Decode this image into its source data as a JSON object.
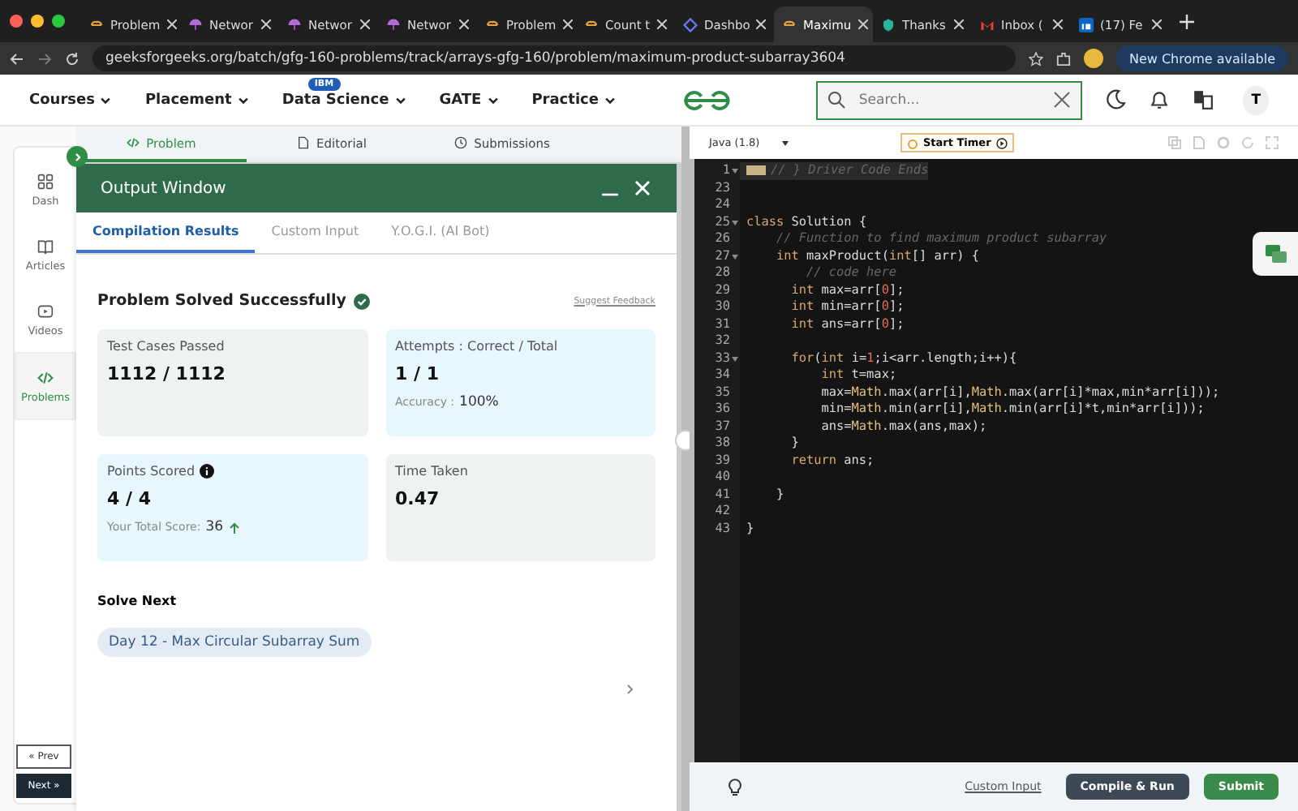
{
  "browser": {
    "tabs": [
      {
        "title": "Problem",
        "selected": false,
        "kind": "gfg"
      },
      {
        "title": "Networ",
        "selected": false,
        "kind": "umbrella"
      },
      {
        "title": "Networ",
        "selected": false,
        "kind": "umbrella"
      },
      {
        "title": "Networ",
        "selected": false,
        "kind": "umbrella"
      },
      {
        "title": "Problem",
        "selected": false,
        "kind": "gfg"
      },
      {
        "title": "Count t",
        "selected": false,
        "kind": "gfg"
      },
      {
        "title": "Dashbo",
        "selected": false,
        "kind": "diamond"
      },
      {
        "title": "Maximu",
        "selected": true,
        "kind": "gfg"
      },
      {
        "title": "Thanks",
        "selected": false,
        "kind": "shield"
      },
      {
        "title": "Inbox (",
        "selected": false,
        "kind": "mail"
      },
      {
        "title": "(17) Fe",
        "selected": false,
        "kind": "network"
      }
    ],
    "url": "geeksforgeeks.org/batch/gfg-160-problems/track/arrays-gfg-160/problem/maximum-product-subarray3604",
    "update_button": "New Chrome available"
  },
  "nav": {
    "items": [
      {
        "label": "Courses"
      },
      {
        "label": "Placement"
      },
      {
        "label": "Data Science",
        "badge": "IBM"
      },
      {
        "label": "GATE"
      },
      {
        "label": "Practice"
      }
    ],
    "search": {
      "placeholder": "Search..."
    },
    "avatar": "T"
  },
  "sidebar": {
    "items": [
      {
        "label": "Dash",
        "kind": "grid",
        "selected": false
      },
      {
        "label": "Articles",
        "kind": "book",
        "selected": false
      },
      {
        "label": "Videos",
        "kind": "video",
        "selected": false
      },
      {
        "label": "Problems",
        "kind": "code",
        "selected": true
      }
    ],
    "prev": "« Prev",
    "next": "Next »"
  },
  "problem_tabs": [
    {
      "label": "Problem",
      "kind": "code",
      "selected": true
    },
    {
      "label": "Editorial",
      "kind": "document",
      "selected": false
    },
    {
      "label": "Submissions",
      "kind": "clock",
      "selected": false
    }
  ],
  "output_window": {
    "title": "Output Window",
    "tabs": [
      {
        "label": "Compilation Results",
        "selected": true
      },
      {
        "label": "Custom Input",
        "selected": false
      },
      {
        "label": "Y.O.G.I. (AI Bot)",
        "selected": false
      }
    ],
    "status": "Problem Solved Successfully",
    "feedback_link": "Suggest Feedback",
    "cards": [
      {
        "label": "Test Cases Passed",
        "value": "1112 / 1112",
        "kind": "plain"
      },
      {
        "label": "Attempts : Correct / Total",
        "value": "1 / 1",
        "kind": "highlight",
        "sub_label": "Accuracy :",
        "sub_value": "100%"
      },
      {
        "label": "Points Scored",
        "value": "4 / 4",
        "kind": "highlight",
        "info": true,
        "sub_label": "Your Total Score:",
        "sub_value": "36",
        "rising": true
      },
      {
        "label": "Time Taken",
        "value": "0.47",
        "kind": "plain"
      }
    ],
    "solve_next": {
      "heading": "Solve Next",
      "items": [
        "Day 12 - Max Circular Subarray Sum"
      ]
    }
  },
  "editor": {
    "language": "Java (1.8)",
    "timer_button": "Start Timer",
    "lines": [
      {
        "number": "1",
        "fold": true,
        "collapsed": true,
        "segments": [
          {
            "kind": "comment",
            "text": "// } Driver Code Ends"
          }
        ]
      },
      {
        "number": "23",
        "fold": false
      },
      {
        "number": "24",
        "fold": false
      },
      {
        "number": "25",
        "fold": true,
        "segments": [
          {
            "kind": "keyword",
            "text": "class"
          },
          {
            "kind": "plain",
            "text": " Solution {"
          }
        ]
      },
      {
        "number": "26",
        "fold": false,
        "segments": [
          {
            "kind": "comment",
            "text": "    // Function to find maximum product subarray"
          }
        ]
      },
      {
        "number": "27",
        "fold": true,
        "segments": [
          {
            "kind": "keyword",
            "text": "    int"
          },
          {
            "kind": "plain",
            "text": " maxProduct("
          },
          {
            "kind": "keyword",
            "text": "int"
          },
          {
            "kind": "plain",
            "text": "[] arr) {"
          }
        ]
      },
      {
        "number": "28",
        "fold": false,
        "segments": [
          {
            "kind": "comment",
            "text": "        // code here"
          }
        ]
      },
      {
        "number": "29",
        "fold": false,
        "segments": [
          {
            "kind": "keyword",
            "text": "      int"
          },
          {
            "kind": "plain",
            "text": " max=arr["
          },
          {
            "kind": "number",
            "text": "0"
          },
          {
            "kind": "plain",
            "text": "];"
          }
        ]
      },
      {
        "number": "30",
        "fold": false,
        "segments": [
          {
            "kind": "keyword",
            "text": "      int"
          },
          {
            "kind": "plain",
            "text": " min=arr["
          },
          {
            "kind": "number",
            "text": "0"
          },
          {
            "kind": "plain",
            "text": "];"
          }
        ]
      },
      {
        "number": "31",
        "fold": false,
        "segments": [
          {
            "kind": "keyword",
            "text": "      int"
          },
          {
            "kind": "plain",
            "text": " ans=arr["
          },
          {
            "kind": "number",
            "text": "0"
          },
          {
            "kind": "plain",
            "text": "];"
          }
        ]
      },
      {
        "number": "32",
        "fold": false
      },
      {
        "number": "33",
        "fold": true,
        "segments": [
          {
            "kind": "keyword",
            "text": "      for"
          },
          {
            "kind": "plain",
            "text": "("
          },
          {
            "kind": "keyword",
            "text": "int"
          },
          {
            "kind": "plain",
            "text": " i="
          },
          {
            "kind": "number",
            "text": "1"
          },
          {
            "kind": "plain",
            "text": ";i<arr.length;i++){"
          }
        ]
      },
      {
        "number": "34",
        "fold": false,
        "segments": [
          {
            "kind": "keyword",
            "text": "          int"
          },
          {
            "kind": "plain",
            "text": " t=max;"
          }
        ]
      },
      {
        "number": "35",
        "fold": false,
        "segments": [
          {
            "kind": "plain",
            "text": "          max="
          },
          {
            "kind": "class",
            "text": "Math"
          },
          {
            "kind": "plain",
            "text": ".max(arr[i],"
          },
          {
            "kind": "class",
            "text": "Math"
          },
          {
            "kind": "plain",
            "text": ".max(arr[i]*max,min*arr[i]));"
          }
        ]
      },
      {
        "number": "36",
        "fold": false,
        "segments": [
          {
            "kind": "plain",
            "text": "          min="
          },
          {
            "kind": "class",
            "text": "Math"
          },
          {
            "kind": "plain",
            "text": ".min(arr[i],"
          },
          {
            "kind": "class",
            "text": "Math"
          },
          {
            "kind": "plain",
            "text": ".min(arr[i]*t,min*arr[i]));"
          }
        ]
      },
      {
        "number": "37",
        "fold": false,
        "segments": [
          {
            "kind": "plain",
            "text": "          ans="
          },
          {
            "kind": "class",
            "text": "Math"
          },
          {
            "kind": "plain",
            "text": ".max(ans,max);"
          }
        ]
      },
      {
        "number": "38",
        "fold": false,
        "segments": [
          {
            "kind": "plain",
            "text": "      }"
          }
        ]
      },
      {
        "number": "39",
        "fold": false,
        "segments": [
          {
            "kind": "keyword",
            "text": "      return"
          },
          {
            "kind": "plain",
            "text": " ans;"
          }
        ]
      },
      {
        "number": "40",
        "fold": false
      },
      {
        "number": "41",
        "fold": false,
        "segments": [
          {
            "kind": "plain",
            "text": "    }"
          }
        ]
      },
      {
        "number": "42",
        "fold": false
      },
      {
        "number": "43",
        "fold": false,
        "segments": [
          {
            "kind": "plain",
            "text": "}"
          }
        ]
      }
    ],
    "custom_input_link": "Custom Input",
    "compile_button": "Compile & Run",
    "submit_button": "Submit"
  }
}
